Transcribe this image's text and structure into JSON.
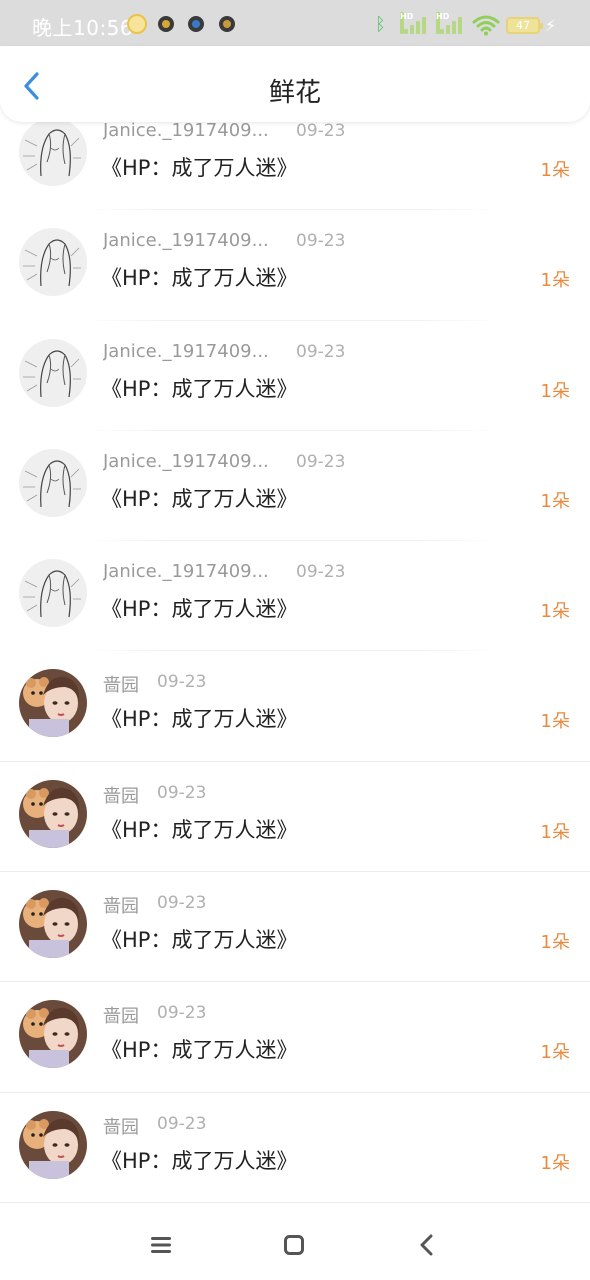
{
  "status_bar": {
    "time": "晚上10:56",
    "battery": "47",
    "hd1": "HD",
    "hd2": "HD"
  },
  "header": {
    "title": "鲜花"
  },
  "colors": {
    "accent_blue": "#3b8ee0",
    "count_orange": "#e98a3f"
  },
  "rows": [
    {
      "user": "Janice._1917409...",
      "date": "09-23",
      "book": "《HP：成了万人迷》",
      "count": "1朵",
      "avatar": "sketch-avatar"
    },
    {
      "user": "Janice._1917409...",
      "date": "09-23",
      "book": "《HP：成了万人迷》",
      "count": "1朵",
      "avatar": "sketch-avatar"
    },
    {
      "user": "Janice._1917409...",
      "date": "09-23",
      "book": "《HP：成了万人迷》",
      "count": "1朵",
      "avatar": "sketch-avatar"
    },
    {
      "user": "Janice._1917409...",
      "date": "09-23",
      "book": "《HP：成了万人迷》",
      "count": "1朵",
      "avatar": "sketch-avatar"
    },
    {
      "user": "Janice._1917409...",
      "date": "09-23",
      "book": "《HP：成了万人迷》",
      "count": "1朵",
      "avatar": "sketch-avatar"
    },
    {
      "user": "啬园",
      "date": "09-23",
      "book": "《HP：成了万人迷》",
      "count": "1朵",
      "avatar": "girl-with-bear-avatar"
    },
    {
      "user": "啬园",
      "date": "09-23",
      "book": "《HP：成了万人迷》",
      "count": "1朵",
      "avatar": "girl-with-bear-avatar"
    },
    {
      "user": "啬园",
      "date": "09-23",
      "book": "《HP：成了万人迷》",
      "count": "1朵",
      "avatar": "girl-with-bear-avatar"
    },
    {
      "user": "啬园",
      "date": "09-23",
      "book": "《HP：成了万人迷》",
      "count": "1朵",
      "avatar": "girl-with-bear-avatar"
    },
    {
      "user": "啬园",
      "date": "09-23",
      "book": "《HP：成了万人迷》",
      "count": "1朵",
      "avatar": "girl-with-bear-avatar"
    }
  ],
  "nav": {
    "menu_icon": "menu-icon",
    "home_icon": "home-icon",
    "back_icon": "back-icon"
  }
}
